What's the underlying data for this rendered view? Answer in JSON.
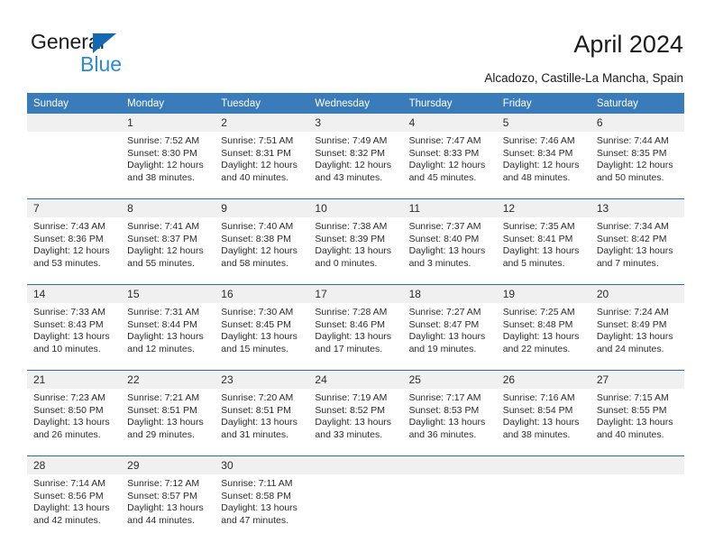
{
  "brand": {
    "name_part1": "General",
    "name_part2": "Blue",
    "accent_color": "#2e8ad4",
    "triangle_color": "#1268b3"
  },
  "header": {
    "title": "April 2024",
    "location": "Alcadozo, Castille-La Mancha, Spain"
  },
  "calendar": {
    "header_bg": "#3a7cba",
    "daynum_bg": "#f0f0f0",
    "separator_color": "#2e6da4",
    "weekday_headers": [
      "Sunday",
      "Monday",
      "Tuesday",
      "Wednesday",
      "Thursday",
      "Friday",
      "Saturday"
    ],
    "weeks": [
      [
        {
          "day": "",
          "sunrise": "",
          "sunset": "",
          "daylight_line1": "",
          "daylight_line2": ""
        },
        {
          "day": "1",
          "sunrise": "Sunrise: 7:52 AM",
          "sunset": "Sunset: 8:30 PM",
          "daylight_line1": "Daylight: 12 hours",
          "daylight_line2": "and 38 minutes."
        },
        {
          "day": "2",
          "sunrise": "Sunrise: 7:51 AM",
          "sunset": "Sunset: 8:31 PM",
          "daylight_line1": "Daylight: 12 hours",
          "daylight_line2": "and 40 minutes."
        },
        {
          "day": "3",
          "sunrise": "Sunrise: 7:49 AM",
          "sunset": "Sunset: 8:32 PM",
          "daylight_line1": "Daylight: 12 hours",
          "daylight_line2": "and 43 minutes."
        },
        {
          "day": "4",
          "sunrise": "Sunrise: 7:47 AM",
          "sunset": "Sunset: 8:33 PM",
          "daylight_line1": "Daylight: 12 hours",
          "daylight_line2": "and 45 minutes."
        },
        {
          "day": "5",
          "sunrise": "Sunrise: 7:46 AM",
          "sunset": "Sunset: 8:34 PM",
          "daylight_line1": "Daylight: 12 hours",
          "daylight_line2": "and 48 minutes."
        },
        {
          "day": "6",
          "sunrise": "Sunrise: 7:44 AM",
          "sunset": "Sunset: 8:35 PM",
          "daylight_line1": "Daylight: 12 hours",
          "daylight_line2": "and 50 minutes."
        }
      ],
      [
        {
          "day": "7",
          "sunrise": "Sunrise: 7:43 AM",
          "sunset": "Sunset: 8:36 PM",
          "daylight_line1": "Daylight: 12 hours",
          "daylight_line2": "and 53 minutes."
        },
        {
          "day": "8",
          "sunrise": "Sunrise: 7:41 AM",
          "sunset": "Sunset: 8:37 PM",
          "daylight_line1": "Daylight: 12 hours",
          "daylight_line2": "and 55 minutes."
        },
        {
          "day": "9",
          "sunrise": "Sunrise: 7:40 AM",
          "sunset": "Sunset: 8:38 PM",
          "daylight_line1": "Daylight: 12 hours",
          "daylight_line2": "and 58 minutes."
        },
        {
          "day": "10",
          "sunrise": "Sunrise: 7:38 AM",
          "sunset": "Sunset: 8:39 PM",
          "daylight_line1": "Daylight: 13 hours",
          "daylight_line2": "and 0 minutes."
        },
        {
          "day": "11",
          "sunrise": "Sunrise: 7:37 AM",
          "sunset": "Sunset: 8:40 PM",
          "daylight_line1": "Daylight: 13 hours",
          "daylight_line2": "and 3 minutes."
        },
        {
          "day": "12",
          "sunrise": "Sunrise: 7:35 AM",
          "sunset": "Sunset: 8:41 PM",
          "daylight_line1": "Daylight: 13 hours",
          "daylight_line2": "and 5 minutes."
        },
        {
          "day": "13",
          "sunrise": "Sunrise: 7:34 AM",
          "sunset": "Sunset: 8:42 PM",
          "daylight_line1": "Daylight: 13 hours",
          "daylight_line2": "and 7 minutes."
        }
      ],
      [
        {
          "day": "14",
          "sunrise": "Sunrise: 7:33 AM",
          "sunset": "Sunset: 8:43 PM",
          "daylight_line1": "Daylight: 13 hours",
          "daylight_line2": "and 10 minutes."
        },
        {
          "day": "15",
          "sunrise": "Sunrise: 7:31 AM",
          "sunset": "Sunset: 8:44 PM",
          "daylight_line1": "Daylight: 13 hours",
          "daylight_line2": "and 12 minutes."
        },
        {
          "day": "16",
          "sunrise": "Sunrise: 7:30 AM",
          "sunset": "Sunset: 8:45 PM",
          "daylight_line1": "Daylight: 13 hours",
          "daylight_line2": "and 15 minutes."
        },
        {
          "day": "17",
          "sunrise": "Sunrise: 7:28 AM",
          "sunset": "Sunset: 8:46 PM",
          "daylight_line1": "Daylight: 13 hours",
          "daylight_line2": "and 17 minutes."
        },
        {
          "day": "18",
          "sunrise": "Sunrise: 7:27 AM",
          "sunset": "Sunset: 8:47 PM",
          "daylight_line1": "Daylight: 13 hours",
          "daylight_line2": "and 19 minutes."
        },
        {
          "day": "19",
          "sunrise": "Sunrise: 7:25 AM",
          "sunset": "Sunset: 8:48 PM",
          "daylight_line1": "Daylight: 13 hours",
          "daylight_line2": "and 22 minutes."
        },
        {
          "day": "20",
          "sunrise": "Sunrise: 7:24 AM",
          "sunset": "Sunset: 8:49 PM",
          "daylight_line1": "Daylight: 13 hours",
          "daylight_line2": "and 24 minutes."
        }
      ],
      [
        {
          "day": "21",
          "sunrise": "Sunrise: 7:23 AM",
          "sunset": "Sunset: 8:50 PM",
          "daylight_line1": "Daylight: 13 hours",
          "daylight_line2": "and 26 minutes."
        },
        {
          "day": "22",
          "sunrise": "Sunrise: 7:21 AM",
          "sunset": "Sunset: 8:51 PM",
          "daylight_line1": "Daylight: 13 hours",
          "daylight_line2": "and 29 minutes."
        },
        {
          "day": "23",
          "sunrise": "Sunrise: 7:20 AM",
          "sunset": "Sunset: 8:51 PM",
          "daylight_line1": "Daylight: 13 hours",
          "daylight_line2": "and 31 minutes."
        },
        {
          "day": "24",
          "sunrise": "Sunrise: 7:19 AM",
          "sunset": "Sunset: 8:52 PM",
          "daylight_line1": "Daylight: 13 hours",
          "daylight_line2": "and 33 minutes."
        },
        {
          "day": "25",
          "sunrise": "Sunrise: 7:17 AM",
          "sunset": "Sunset: 8:53 PM",
          "daylight_line1": "Daylight: 13 hours",
          "daylight_line2": "and 36 minutes."
        },
        {
          "day": "26",
          "sunrise": "Sunrise: 7:16 AM",
          "sunset": "Sunset: 8:54 PM",
          "daylight_line1": "Daylight: 13 hours",
          "daylight_line2": "and 38 minutes."
        },
        {
          "day": "27",
          "sunrise": "Sunrise: 7:15 AM",
          "sunset": "Sunset: 8:55 PM",
          "daylight_line1": "Daylight: 13 hours",
          "daylight_line2": "and 40 minutes."
        }
      ],
      [
        {
          "day": "28",
          "sunrise": "Sunrise: 7:14 AM",
          "sunset": "Sunset: 8:56 PM",
          "daylight_line1": "Daylight: 13 hours",
          "daylight_line2": "and 42 minutes."
        },
        {
          "day": "29",
          "sunrise": "Sunrise: 7:12 AM",
          "sunset": "Sunset: 8:57 PM",
          "daylight_line1": "Daylight: 13 hours",
          "daylight_line2": "and 44 minutes."
        },
        {
          "day": "30",
          "sunrise": "Sunrise: 7:11 AM",
          "sunset": "Sunset: 8:58 PM",
          "daylight_line1": "Daylight: 13 hours",
          "daylight_line2": "and 47 minutes."
        },
        {
          "day": "",
          "sunrise": "",
          "sunset": "",
          "daylight_line1": "",
          "daylight_line2": ""
        },
        {
          "day": "",
          "sunrise": "",
          "sunset": "",
          "daylight_line1": "",
          "daylight_line2": ""
        },
        {
          "day": "",
          "sunrise": "",
          "sunset": "",
          "daylight_line1": "",
          "daylight_line2": ""
        },
        {
          "day": "",
          "sunrise": "",
          "sunset": "",
          "daylight_line1": "",
          "daylight_line2": ""
        }
      ]
    ]
  }
}
